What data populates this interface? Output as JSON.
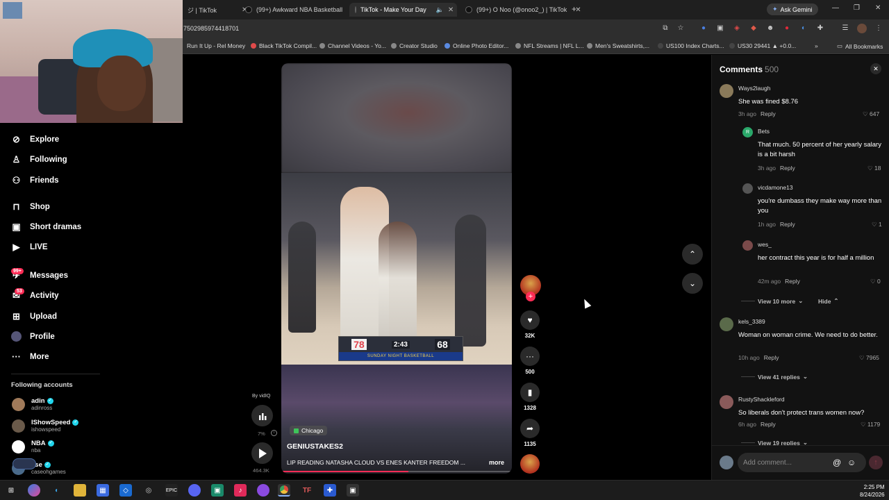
{
  "browser": {
    "tabs": [
      {
        "label": "ジ | TikTok",
        "active": false
      },
      {
        "label": "(99+) Awkward NBA Basketball",
        "active": false
      },
      {
        "label": "TikTok - Make Your Day",
        "active": true
      },
      {
        "label": "(99+) O Noo (@onoo2_) | TikTok",
        "active": false
      }
    ],
    "new_tab": "+",
    "ask_gemini": "Ask Gemini",
    "url": "7502985974418701",
    "bookmarks": [
      "Run It Up - Rel Money",
      "Black TikTok Compil...",
      "Channel Videos - Yo...",
      "Creator Studio",
      "Online Photo Editor...",
      "NFL Streams | NFL L...",
      "Men's Sweatshirts,...",
      "US100 Index Charts...",
      "US30 29441 ▲ +0.0..."
    ],
    "all_bookmarks": "All Bookmarks"
  },
  "sidebar": {
    "nav": [
      {
        "label": "Explore",
        "icon": "compass-icon"
      },
      {
        "label": "Following",
        "icon": "following-icon"
      },
      {
        "label": "Friends",
        "icon": "friends-icon"
      },
      {
        "label": "Shop",
        "icon": "shop-icon"
      },
      {
        "label": "Short dramas",
        "icon": "short-dramas-icon"
      },
      {
        "label": "LIVE",
        "icon": "live-icon"
      },
      {
        "label": "Messages",
        "icon": "messages-icon",
        "badge": "99+"
      },
      {
        "label": "Activity",
        "icon": "activity-icon",
        "badge": "53"
      },
      {
        "label": "Upload",
        "icon": "upload-icon"
      },
      {
        "label": "Profile",
        "icon": "profile-icon"
      },
      {
        "label": "More",
        "icon": "more-icon"
      }
    ],
    "following_header": "Following accounts",
    "accounts": [
      {
        "name": "adin",
        "handle": "adinross"
      },
      {
        "name": "IShowSpeed",
        "handle": "ishowspeed"
      },
      {
        "name": "NBA",
        "handle": "nba"
      },
      {
        "name": "ase",
        "handle": "caseohgames"
      }
    ]
  },
  "video": {
    "location": "Chicago",
    "author": "GENIUSTAKES2",
    "description": "LIP READING NATASHA CLOUD VS ENES KANTER FREEDOM ...",
    "more": "more",
    "progress": 0.55,
    "scoreboard": {
      "score1": "78",
      "clock": "2:43",
      "score2": "68",
      "banner": "SUNDAY NIGHT BASKETBALL"
    }
  },
  "vidiq": {
    "by": "By vidIQ",
    "percent": "7%",
    "views": "464.3K"
  },
  "actions": {
    "likes": "32K",
    "comments": "500",
    "saves": "1328",
    "shares": "1135"
  },
  "comments_panel": {
    "title": "Comments",
    "count": "500",
    "comments": [
      {
        "user": "Ways2laugh",
        "text": "She was fined $8.76",
        "time": "3h ago",
        "reply": "Reply",
        "likes": "647"
      },
      {
        "user": "Bets",
        "text": "That much. 50 percent of her yearly salary is a bit harsh",
        "time": "3h ago",
        "reply": "Reply",
        "likes": "18"
      },
      {
        "user": "vicdamone13",
        "text": "you're dumbass they make way more than you",
        "time": "1h ago",
        "reply": "Reply",
        "likes": "1"
      },
      {
        "user": "wes_",
        "text": "her contract this year is for half a million",
        "time": "42m ago",
        "reply": "Reply",
        "likes": "0"
      },
      {
        "user": "kels_3389",
        "text": "Woman on woman crime. We need to do better.",
        "time": "10h ago",
        "reply": "Reply",
        "likes": "7965"
      },
      {
        "user": "RustyShackleford",
        "text": "So liberals don't protect trans women now?",
        "time": "6h ago",
        "reply": "Reply",
        "likes": "1179"
      }
    ],
    "view_more": "View 10 more",
    "hide": "Hide",
    "view_replies_1": "View 41 replies",
    "view_replies_2": "View 19 replies",
    "input_placeholder": "Add comment..."
  },
  "taskbar": {
    "time": "2:25 PM",
    "date": "8/24/2026"
  },
  "colors": {
    "accent": "#fe2c55",
    "panel": "#121212"
  }
}
